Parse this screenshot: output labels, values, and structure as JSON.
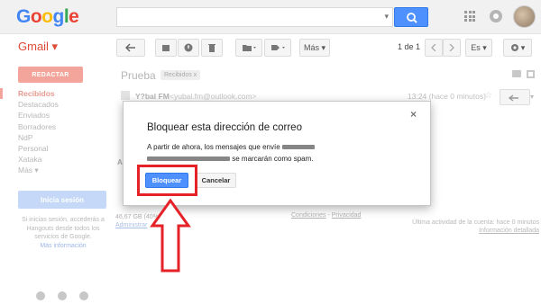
{
  "header": {
    "logo_letters": [
      "G",
      "o",
      "o",
      "g",
      "l",
      "e"
    ],
    "logo_colors": [
      "#4285f4",
      "#ea4335",
      "#fbbc05",
      "#4285f4",
      "#34a853",
      "#ea4335"
    ],
    "search_dropdown": "▾"
  },
  "toolbar": {
    "gmail_label": "Gmail ▾",
    "more_label": "Más ▾",
    "page_count": "1 de 1",
    "language_label": "Es ▾",
    "settings_label": "▾"
  },
  "sidebar": {
    "compose_label": "REDACTAR",
    "items": [
      {
        "label": "Recibidos",
        "active": true
      },
      {
        "label": "Destacados",
        "active": false
      },
      {
        "label": "Enviados",
        "active": false
      },
      {
        "label": "Borradores",
        "active": false
      },
      {
        "label": "NdP",
        "active": false
      },
      {
        "label": "Personal",
        "active": false
      },
      {
        "label": "Xataka",
        "active": false
      },
      {
        "label": "Más ▾",
        "active": false
      }
    ],
    "signin_label": "Inicia sesión",
    "hangouts_text": "Si inicias sesión, accederás a Hangouts desde todos los servicios de Google.",
    "hangouts_link": "Más información"
  },
  "message": {
    "subject": "Prueba",
    "label_chip": "Recibidos  x",
    "sender_name": "Y?bal FM",
    "sender_email": "<yubal.fm@outlook.com>",
    "time": "13:24 (hace 0 minutos)",
    "star": "☆",
    "faded_text": "A"
  },
  "footer": {
    "storage": "46,67 GB (40%",
    "admin_link": "Administrar",
    "conditions": "Condiciones",
    "separator": " - ",
    "privacy": "Privacidad",
    "activity": "Última actividad de la cuenta: hace 0 minutos",
    "details": "Información detallada"
  },
  "dialog": {
    "title": "Bloquear esta dirección de correo",
    "close": "×",
    "body_line1": "A partir de ahora, los mensajes que envíe",
    "body_line2_suffix": "se marcarán como spam.",
    "block_label": "Bloquear",
    "cancel_label": "Cancelar"
  },
  "colors": {
    "annotation_red": "#e52227",
    "primary_blue": "#4d90fe",
    "gmail_red": "#dd4b39"
  }
}
